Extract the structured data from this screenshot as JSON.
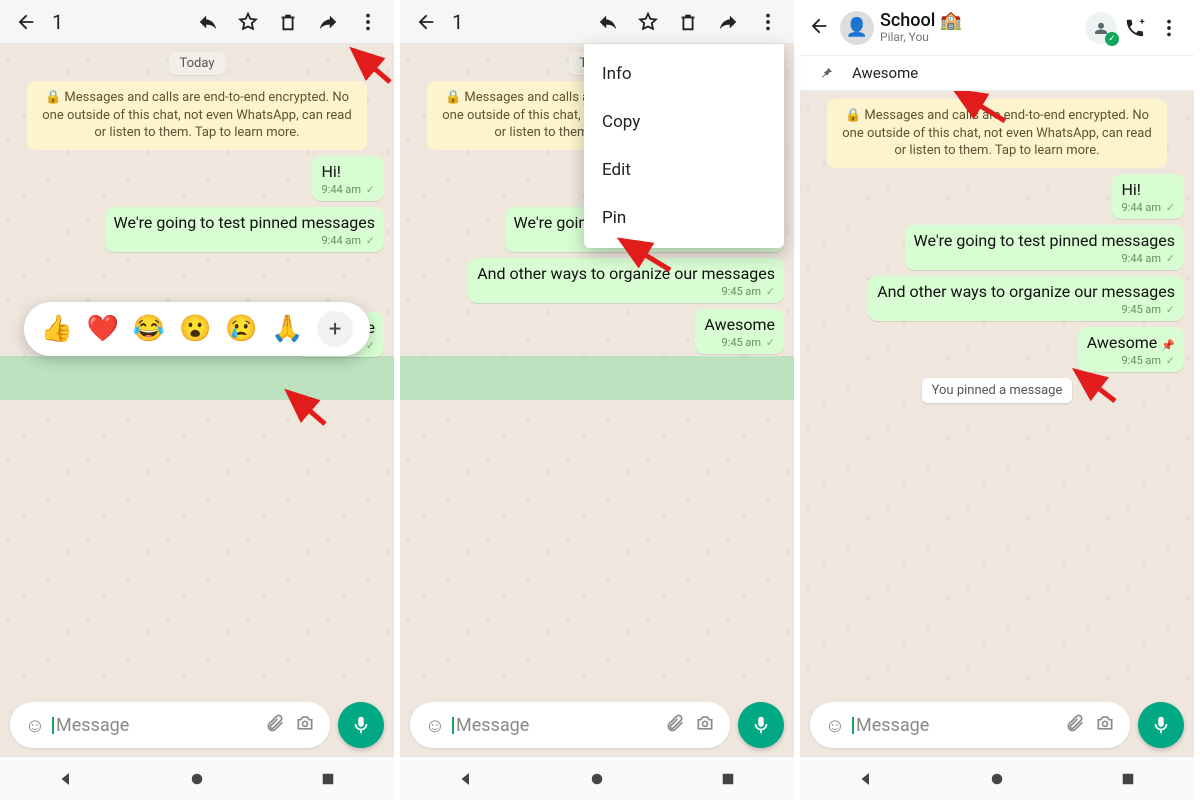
{
  "selection_count": "1",
  "date_label": "Today",
  "encryption_banner": "🔒 Messages and calls are end-to-end encrypted. No one outside of this chat, not even WhatsApp, can read or listen to them. Tap to learn more.",
  "messages": {
    "m1": {
      "text": "Hi!",
      "time": "9:44 am"
    },
    "m2": {
      "text": "We're going to test pinned messages",
      "time": "9:44 am"
    },
    "m3": {
      "text": "And other ways to organize our messages",
      "time": "9:45 am"
    },
    "m4": {
      "text": "Awesome",
      "time": "9:45 am"
    }
  },
  "reactions": [
    "👍",
    "❤️",
    "😂",
    "😮",
    "😢",
    "🙏"
  ],
  "menu": {
    "info": "Info",
    "copy": "Copy",
    "edit": "Edit",
    "pin": "Pin"
  },
  "group": {
    "title": "School 🏫",
    "subtitle": "Pilar, You"
  },
  "pinned_banner_text": "Awesome",
  "system_pinned": "You pinned a message",
  "input_placeholder": "Message"
}
